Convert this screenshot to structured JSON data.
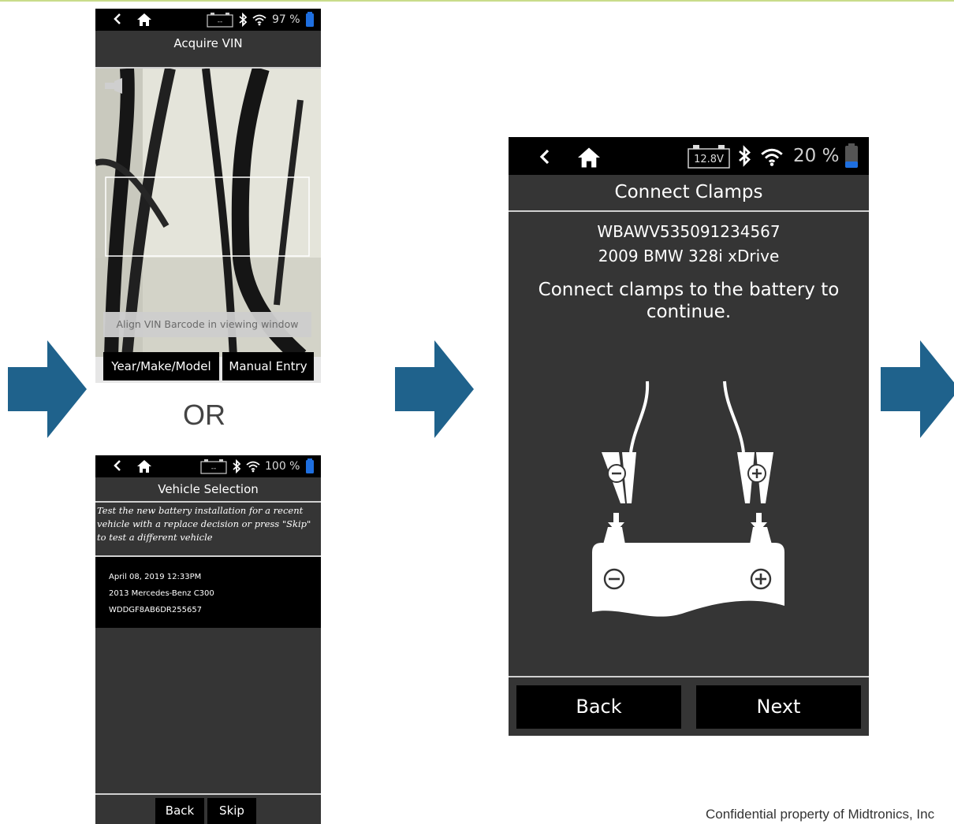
{
  "colors": {
    "accent_arrow": "#1f628c",
    "screen_bg": "#353535",
    "status_bar": "#000000",
    "battery_fill": "#1e6fe0"
  },
  "flow": {
    "or_label": "OR"
  },
  "acquire_vin": {
    "status": {
      "back_icon": "chevron-left-icon",
      "home_icon": "home-icon",
      "clamp_icon": "battery-clamp-icon",
      "clamp_value": "--",
      "battery_pct": "97 %"
    },
    "title": "Acquire VIN",
    "hint": "Align VIN Barcode in viewing window",
    "buttons": {
      "ymm": "Year/Make/Model",
      "manual": "Manual Entry"
    }
  },
  "vehicle_selection": {
    "status": {
      "clamp_value": "--",
      "battery_pct": "100 %"
    },
    "title": "Vehicle Selection",
    "description": "Test the new battery installation for a recent vehicle with a replace decision or press \"Skip\" to test a different vehicle",
    "recent": {
      "date": "April 08, 2019 12:33PM",
      "vehicle": "2013 Mercedes-Benz C300",
      "vin": "WDDGF8AB6DR255657"
    },
    "buttons": {
      "back": "Back",
      "skip": "Skip"
    }
  },
  "connect_clamps": {
    "status": {
      "voltage": "12.8V",
      "battery_pct": "20 %"
    },
    "title": "Connect Clamps",
    "vin": "WBAWV535091234567",
    "vehicle": "2009 BMW 328i xDrive",
    "message": "Connect clamps to the battery to continue.",
    "buttons": {
      "back": "Back",
      "next": "Next"
    }
  },
  "footer": {
    "confidential": "Confidential property of Midtronics, Inc"
  }
}
